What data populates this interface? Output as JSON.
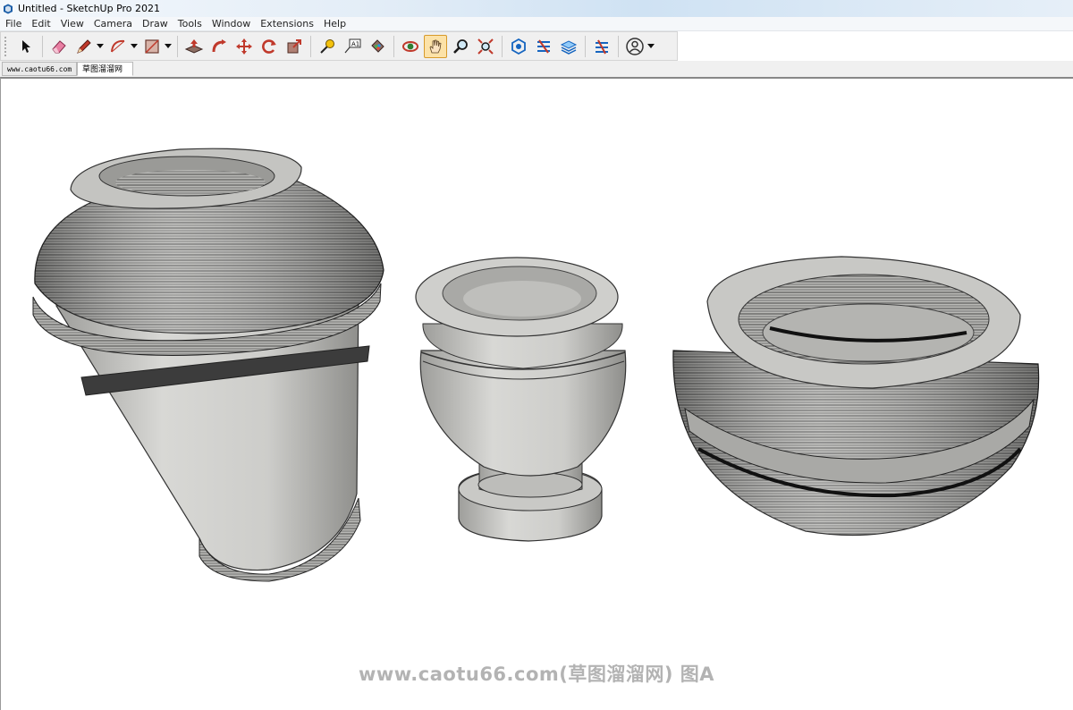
{
  "window": {
    "title": "Untitled - SketchUp Pro 2021"
  },
  "menu": [
    "File",
    "Edit",
    "View",
    "Camera",
    "Draw",
    "Tools",
    "Window",
    "Extensions",
    "Help"
  ],
  "tabs": [
    "www.caotu66.com",
    "草图溜溜网"
  ],
  "watermark": "www.caotu66.com(草图溜溜网) 图A",
  "toolbar_icons": [
    "select-icon",
    "eraser-icon",
    "pencil-icon",
    "arc-icon",
    "rectangle-icon",
    "push-pull-icon",
    "follow-me-icon",
    "move-icon",
    "rotate-icon",
    "scale-icon",
    "tape-measure-icon",
    "text-icon",
    "paint-bucket-icon",
    "orbit-icon",
    "pan-icon",
    "zoom-icon",
    "zoom-extents-icon",
    "warehouse-icon",
    "extension-warehouse-icon",
    "layout-icon",
    "sandbox-icon",
    "account-icon"
  ],
  "colors": {
    "accent": "#fce2a8",
    "model_stone": "#cfcfcc",
    "model_lines": "#3a3a3a"
  }
}
